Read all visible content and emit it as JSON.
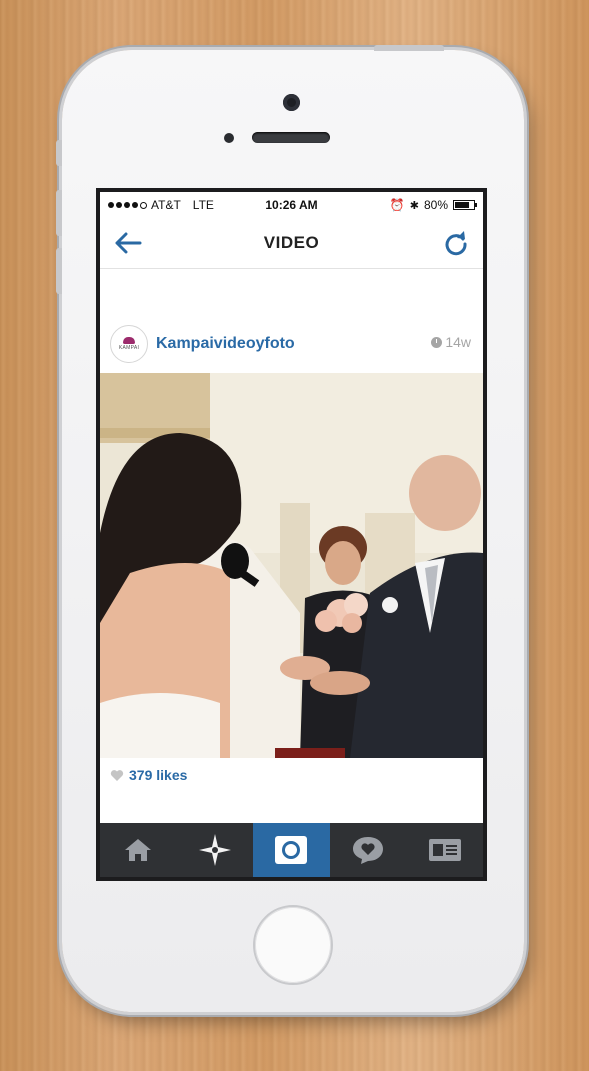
{
  "status_bar": {
    "carrier": "AT&T",
    "network": "LTE",
    "time": "10:26 AM",
    "battery": "80%",
    "battery_level": 0.8,
    "signal_bars": 4
  },
  "nav": {
    "title": "VIDEO"
  },
  "post": {
    "username": "Kampaivideoyfoto",
    "avatar_text": "KAMPAI",
    "age": "14w",
    "likes": "379 likes"
  },
  "tabs": [
    "home",
    "explore",
    "camera",
    "activity",
    "profile"
  ],
  "colors": {
    "accent": "#2a69a3",
    "link": "#2a6aa6",
    "tabbar": "#2f3134"
  }
}
